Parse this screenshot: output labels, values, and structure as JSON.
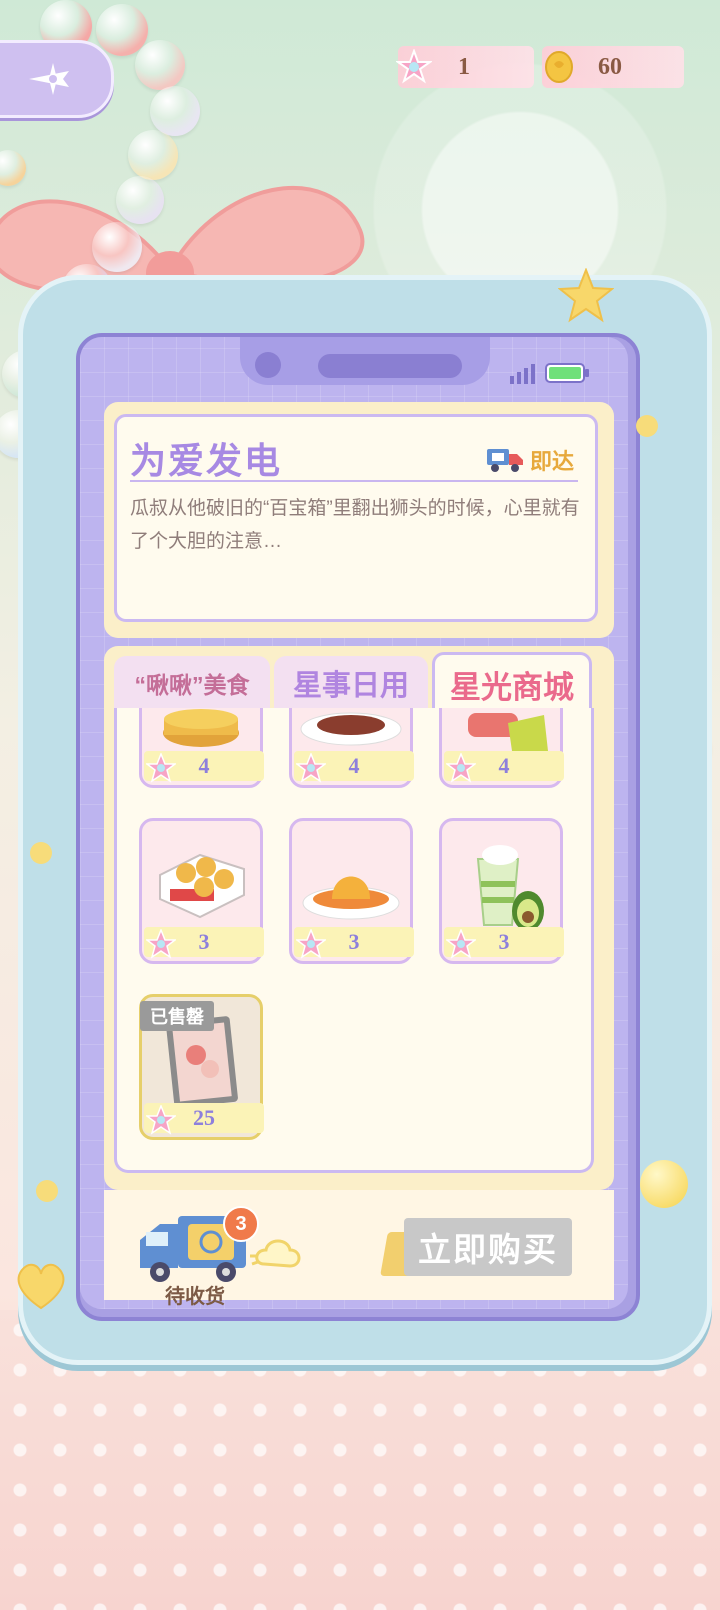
{
  "currency": {
    "stars": "1",
    "coins": "60"
  },
  "card": {
    "title": "为爱发电",
    "delivery_label": "即达",
    "description": "瓜叔从他破旧的“百宝箱”里翻出狮头的时候，心里就有了个大胆的注意…"
  },
  "tabs": [
    {
      "label": "“啾啾”美食"
    },
    {
      "label": "星事日用"
    },
    {
      "label": "星光商城"
    }
  ],
  "items": [
    {
      "price": "4",
      "icon": "egg-tart-icon"
    },
    {
      "price": "4",
      "icon": "steak-plate-icon"
    },
    {
      "price": "4",
      "icon": "durian-dessert-icon"
    },
    {
      "price": "3",
      "icon": "egg-tart-box-icon"
    },
    {
      "price": "3",
      "icon": "pudding-plate-icon"
    },
    {
      "price": "3",
      "icon": "avocado-smoothie-icon"
    },
    {
      "price": "25",
      "icon": "framed-picture-icon",
      "sold_label": "已售罄"
    }
  ],
  "bottom": {
    "pending_badge": "3",
    "pending_label": "待收货",
    "buy_label": "立即购买"
  },
  "colors": {
    "accent_purple": "#a789e3",
    "active_tab": "#ea6a8c",
    "delivery": "#e7a93c",
    "disabled_button": "#c8c8c8"
  }
}
